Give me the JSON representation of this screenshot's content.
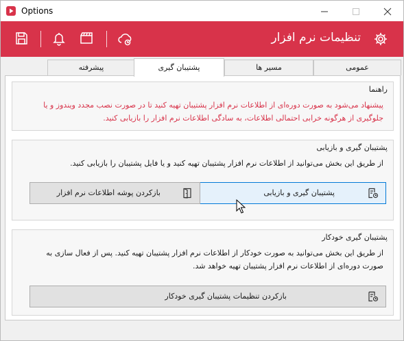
{
  "window": {
    "title": "Options"
  },
  "header": {
    "title": "تنظیمات نرم افزار",
    "accent_color": "#d8334a",
    "tools": [
      "save-icon",
      "bell-icon",
      "clapper-icon",
      "cloud-sync-icon"
    ]
  },
  "tabs": [
    {
      "label": "عمومی"
    },
    {
      "label": "مسیر ها"
    },
    {
      "label": "پشتیبان گیری",
      "active": true
    },
    {
      "label": "پیشرفته"
    }
  ],
  "guide": {
    "title": "راهنما",
    "line1": "پیشنهاد می‌شود به صورت دوره‌ای از اطلاعات نرم افزار پشتیبان تهیه کنید تا در صورت نصب مجدد ویندوز و یا",
    "line2": "جلوگیری از هرگونه خرابی احتمالی اطلاعات، به سادگی اطلاعات نرم افزار را بازیابی کنید."
  },
  "backup": {
    "title": "پشتیبان گیری و بازیابی",
    "description": "از طریق این بخش می‌توانید از اطلاعات نرم افزار پشتیبان تهیه کنید و یا فایل پشتیبان را بازیابی کنید.",
    "backup_button": "پشتیبان گیری و بازیابی",
    "restore_folder_button": "بازکردن پوشه اطلاعات نرم افزار"
  },
  "auto_backup": {
    "title": "پشتیبان گیری خودکار",
    "line1": "از طریق این بخش می‌توانید به صورت خودکار از اطلاعات نرم افزار پشتیبان تهیه کنید. پس از فعال سازی به",
    "line2": "صورت دوره‌ای از اطلاعات نرم افزار پشتیبان تهیه خواهد شد.",
    "settings_button": "بازکردن تنظیمات پشتیبان گیری خودکار"
  }
}
